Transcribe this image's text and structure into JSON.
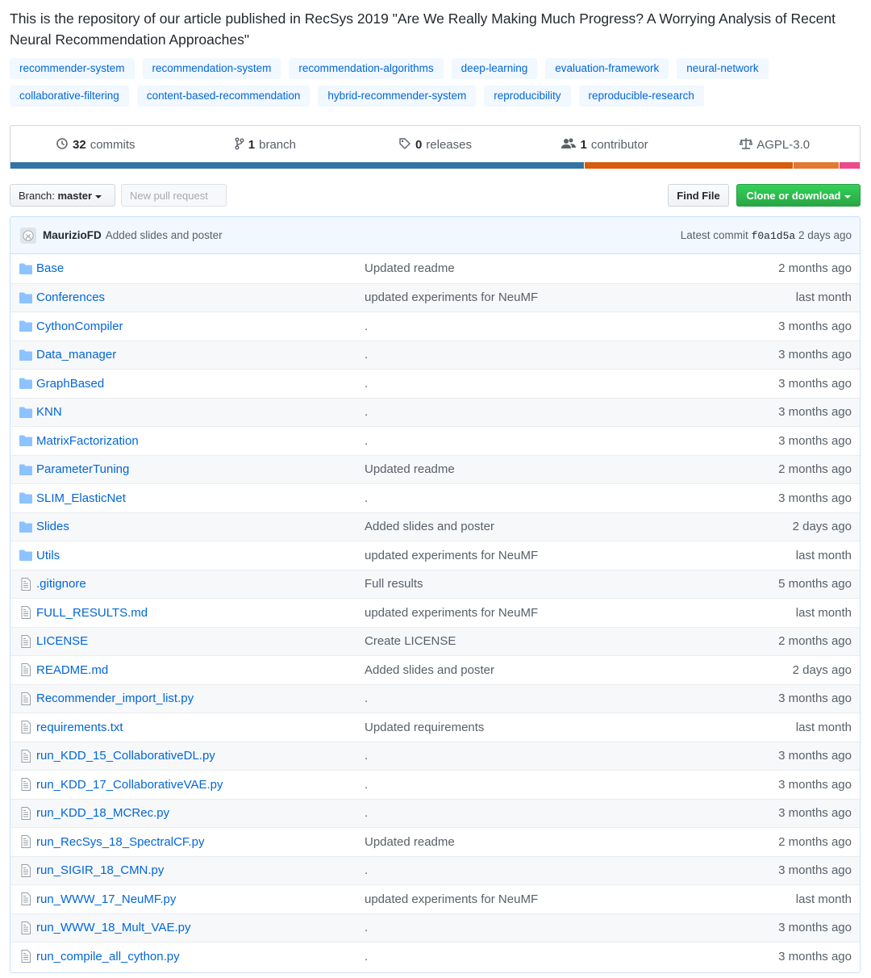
{
  "description": "This is the repository of our article published in RecSys 2019 \"Are We Really Making Much Progress? A Worrying Analysis of Recent Neural Recommendation Approaches\"",
  "topics_row1": [
    "recommender-system",
    "recommendation-system",
    "recommendation-algorithms",
    "deep-learning",
    "evaluation-framework",
    "neural-network"
  ],
  "topics_row2": [
    "collaborative-filtering",
    "content-based-recommendation",
    "hybrid-recommender-system",
    "reproducibility",
    "reproducible-research"
  ],
  "summary": {
    "commits_count": "32",
    "commits_label": "commits",
    "branch_count": "1",
    "branch_label": "branch",
    "releases_count": "0",
    "releases_label": "releases",
    "contributor_count": "1",
    "contributor_label": "contributor",
    "license": "AGPL-3.0"
  },
  "language_bar": [
    {
      "share": 0.677,
      "color": "#3572A5"
    },
    {
      "share": 0.246,
      "color": "#DA5B0B"
    },
    {
      "share": 0.053,
      "color": "#e37933"
    },
    {
      "share": 0.024,
      "color": "#ec4a8d"
    }
  ],
  "buttons": {
    "branch_prefix": "Branch:",
    "branch_name": "master",
    "new_pr": "New pull request",
    "find_file": "Find File",
    "clone": "Clone or download"
  },
  "commit": {
    "author": "MaurizioFD",
    "message": "Added slides and poster",
    "latest_label": "Latest commit",
    "sha": "f0a1d5a",
    "age": "2 days ago"
  },
  "files": [
    {
      "type": "dir",
      "name": "Base",
      "message": "Updated readme",
      "age": "2 months ago"
    },
    {
      "type": "dir",
      "name": "Conferences",
      "message": "updated experiments for NeuMF",
      "age": "last month"
    },
    {
      "type": "dir",
      "name": "CythonCompiler",
      "message": ".",
      "age": "3 months ago"
    },
    {
      "type": "dir",
      "name": "Data_manager",
      "message": ".",
      "age": "3 months ago"
    },
    {
      "type": "dir",
      "name": "GraphBased",
      "message": ".",
      "age": "3 months ago"
    },
    {
      "type": "dir",
      "name": "KNN",
      "message": ".",
      "age": "3 months ago"
    },
    {
      "type": "dir",
      "name": "MatrixFactorization",
      "message": ".",
      "age": "3 months ago"
    },
    {
      "type": "dir",
      "name": "ParameterTuning",
      "message": "Updated readme",
      "age": "2 months ago"
    },
    {
      "type": "dir",
      "name": "SLIM_ElasticNet",
      "message": ".",
      "age": "3 months ago"
    },
    {
      "type": "dir",
      "name": "Slides",
      "message": "Added slides and poster",
      "age": "2 days ago"
    },
    {
      "type": "dir",
      "name": "Utils",
      "message": "updated experiments for NeuMF",
      "age": "last month"
    },
    {
      "type": "file",
      "name": ".gitignore",
      "message": "Full results",
      "age": "5 months ago"
    },
    {
      "type": "file",
      "name": "FULL_RESULTS.md",
      "message": "updated experiments for NeuMF",
      "age": "last month"
    },
    {
      "type": "file",
      "name": "LICENSE",
      "message": "Create LICENSE",
      "age": "2 months ago"
    },
    {
      "type": "file",
      "name": "README.md",
      "message": "Added slides and poster",
      "age": "2 days ago"
    },
    {
      "type": "file",
      "name": "Recommender_import_list.py",
      "message": ".",
      "age": "3 months ago"
    },
    {
      "type": "file",
      "name": "requirements.txt",
      "message": "Updated requirements",
      "age": "last month"
    },
    {
      "type": "file",
      "name": "run_KDD_15_CollaborativeDL.py",
      "message": ".",
      "age": "3 months ago"
    },
    {
      "type": "file",
      "name": "run_KDD_17_CollaborativeVAE.py",
      "message": ".",
      "age": "3 months ago"
    },
    {
      "type": "file",
      "name": "run_KDD_18_MCRec.py",
      "message": ".",
      "age": "3 months ago"
    },
    {
      "type": "file",
      "name": "run_RecSys_18_SpectralCF.py",
      "message": "Updated readme",
      "age": "2 months ago"
    },
    {
      "type": "file",
      "name": "run_SIGIR_18_CMN.py",
      "message": ".",
      "age": "3 months ago"
    },
    {
      "type": "file",
      "name": "run_WWW_17_NeuMF.py",
      "message": "updated experiments for NeuMF",
      "age": "last month"
    },
    {
      "type": "file",
      "name": "run_WWW_18_Mult_VAE.py",
      "message": ".",
      "age": "3 months ago"
    },
    {
      "type": "file",
      "name": "run_compile_all_cython.py",
      "message": ".",
      "age": "3 months ago"
    }
  ]
}
